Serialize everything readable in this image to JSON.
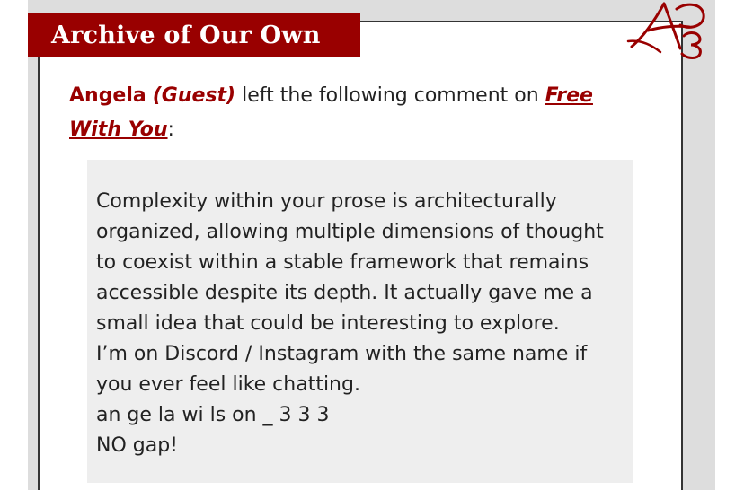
{
  "header": {
    "title": "Archive of Our Own"
  },
  "comment": {
    "author": "Angela",
    "guest_label": "(Guest)",
    "action_text": " left the following comment on ",
    "work_title": "Free With You",
    "trailing_punct": ":",
    "body_lines": [
      "Complexity within your prose is architecturally",
      "organized, allowing multiple dimensions of thought",
      "to coexist within a stable framework that remains",
      "accessible despite its depth. It actually gave me a",
      "small idea that could be interesting to explore.",
      "I’m on Discord / Instagram with the same name if",
      "you ever feel like chatting.",
      "an ge la wi ls on _ 3 3 3",
      "NO gap!"
    ]
  },
  "colors": {
    "brand_red": "#990000",
    "frame_gray": "#dddddd",
    "comment_bg": "#eeeeee",
    "text": "#222222"
  },
  "logo": {
    "icon": "ao3-logo-icon"
  }
}
